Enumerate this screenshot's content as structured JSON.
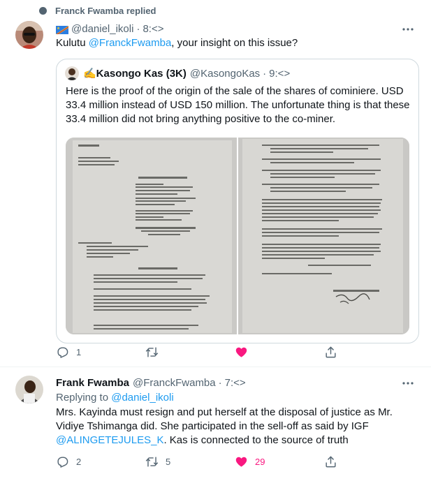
{
  "colors": {
    "accent": "#1d9bf0",
    "like": "#f91880",
    "muted": "#536471"
  },
  "social_context": {
    "text": "Franck Fwamba replied",
    "icon": "dot-icon"
  },
  "tweet1": {
    "display_name": "",
    "handle": "@daniel_ikoli",
    "separator": "·",
    "time": "8:<>",
    "text_before": "Kulutu ",
    "mention": "@FranckFwamba",
    "text_after": ", your insight on this issue?",
    "quote": {
      "display_name": "✍️Kasongo Kas (3K)",
      "handle": "@KasongoKas",
      "separator": "·",
      "time": "9:<>",
      "text": "Here is the proof of the origin of the sale of the shares of cominiere. USD 33.4 million instead of USD 150 million. The unfortunate thing is that these 33.4 million did not bring anything positive to the co-miner."
    },
    "stats": {
      "replies": "1",
      "retweets": "",
      "likes": ""
    }
  },
  "tweet2": {
    "display_name": "Frank Fwamba",
    "handle": "@FranckFwamba",
    "separator": "·",
    "time": "7:<>",
    "replying_prefix": "Replying to ",
    "replying_to": "@daniel_ikoli",
    "text_line1": "Mrs. Kayinda must resign and put herself at the disposal of justice as Mr.",
    "text_line2": "Vidiye Tshimanga did. She participated in the sell-off as said by IGF",
    "mention": "@ALINGETEJULES_K",
    "text_after": ". Kas is connected to the source of truth",
    "stats": {
      "replies": "2",
      "retweets": "5",
      "likes": "29"
    }
  }
}
